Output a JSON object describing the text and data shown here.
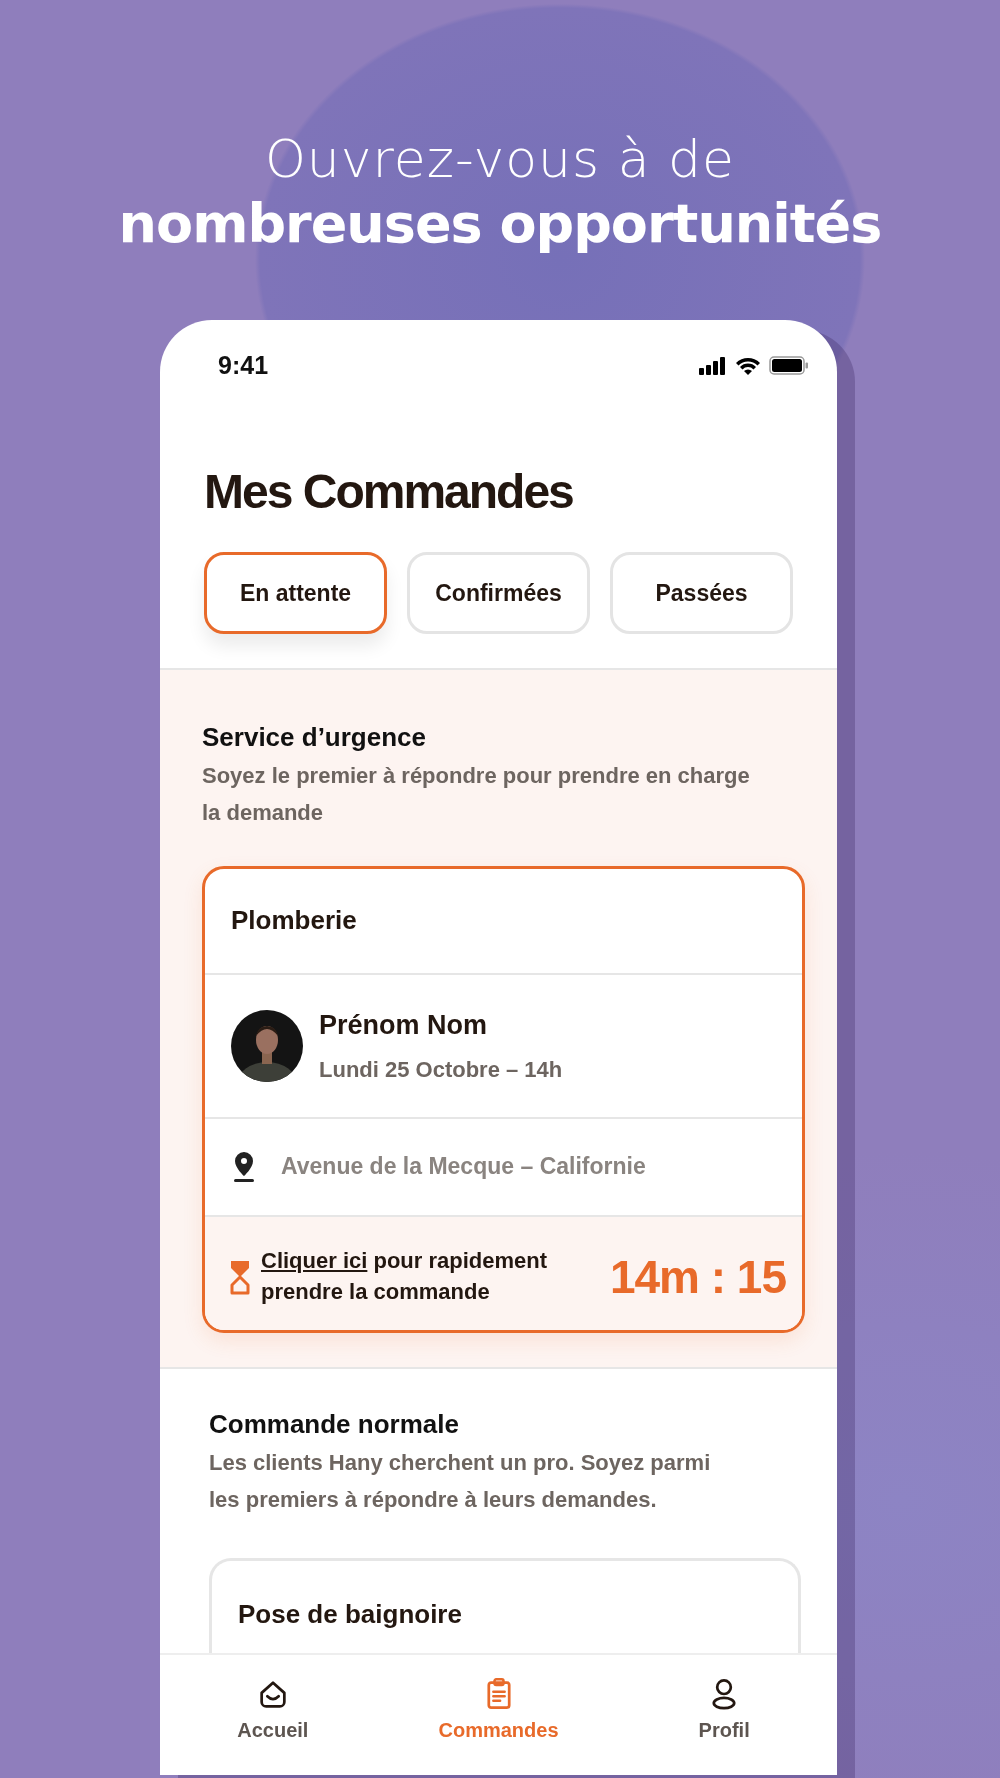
{
  "headline": {
    "line_1": "Ouvrez-vous à de",
    "line_2": "nombreuses opportunités"
  },
  "status_bar": {
    "time": "9:41"
  },
  "title": "Mes Commandes",
  "tabs": [
    {
      "label": "En attente",
      "selected": true
    },
    {
      "label": "Confirmées",
      "selected": false
    },
    {
      "label": "Passées",
      "selected": false
    }
  ],
  "urgent_section": {
    "title": "Service d’urgence",
    "subtitle": "Soyez le premier à répondre pour prendre en charge la demande",
    "card": {
      "category": "Plomberie",
      "client_name": "Prénom Nom",
      "date": "Lundi 25 Octobre – 14h",
      "address": "Avenue de la Mecque – Californie",
      "link": "Cliquer ici",
      "action_text": " pour rapidement prendre la commande",
      "timer": "14m : 15"
    }
  },
  "normal_section": {
    "title": "Commande normale",
    "subtitle": "Les clients Hany cherchent un pro. Soyez parmi les premiers à répondre à leurs demandes.",
    "card": {
      "category": "Pose de baignoire"
    }
  },
  "bottom_nav": [
    {
      "label": "Accueil",
      "selected": false
    },
    {
      "label": "Commandes",
      "selected": true
    },
    {
      "label": "Profil",
      "selected": false
    }
  ]
}
